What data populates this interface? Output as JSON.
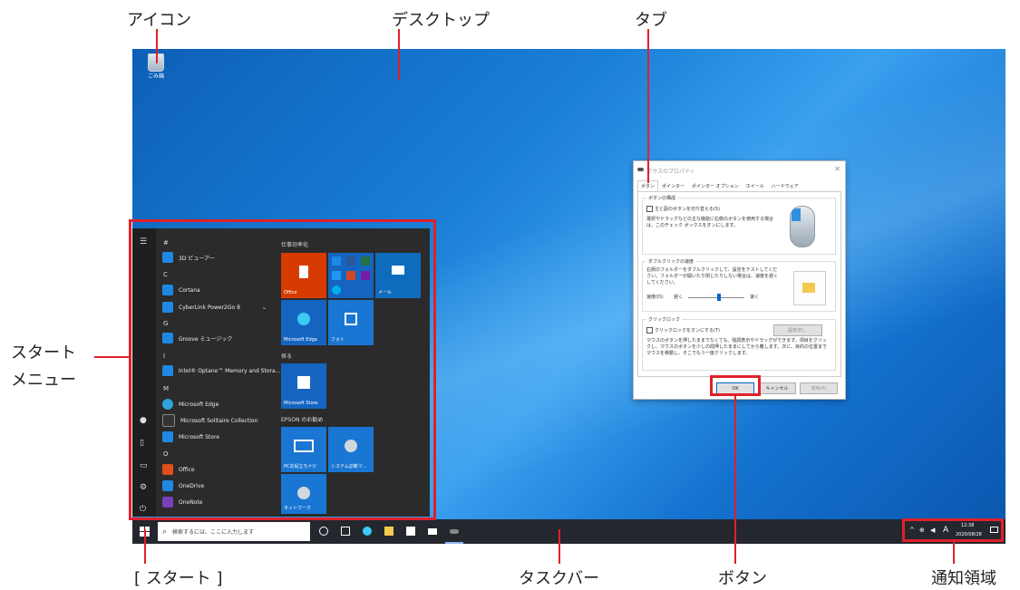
{
  "callouts": {
    "icon": "アイコン",
    "desktop": "デスクトップ",
    "tab": "タブ",
    "start_menu_1": "スタート",
    "start_menu_2": "メニュー",
    "start_button": "[ スタート ]",
    "taskbar": "タスクバー",
    "button": "ボタン",
    "notification_area": "通知領域"
  },
  "desktop": {
    "recycle_bin_label": "ごみ箱"
  },
  "start_menu": {
    "sections": {
      "hash": "#",
      "c": "C",
      "g": "G",
      "i": "I",
      "m": "M",
      "o": "O"
    },
    "apps": {
      "viewer3d": "3D ビューアー",
      "cortana": "Cortana",
      "cyberlink": "CyberLink Power2Go 8",
      "groove": "Groove ミュージック",
      "optane": "Intel® Optane™ Memory and Stora...",
      "edge": "Microsoft Edge",
      "solitaire": "Microsoft Solitaire Collection",
      "store": "Microsoft Store",
      "office": "Office",
      "onedrive": "OneDrive",
      "onenote": "OneNote"
    },
    "groups": {
      "productivity": "仕事効率化",
      "explore": "探る",
      "epson": "EPSON のお勧め"
    },
    "tiles": {
      "office": "Office",
      "mail": "メール",
      "edge": "Microsoft Edge",
      "photos": "フォト",
      "store": "Microsoft Store",
      "pc_help": "PCお役立ちナビ",
      "diag": "システム診断ツ...",
      "network": "ネットワーク"
    }
  },
  "taskbar": {
    "search_placeholder": "検索するには、ここに入力します",
    "ime": "A",
    "time": "12:38",
    "date": "2020/08/28"
  },
  "dialog": {
    "title": "マウスのプロパティ",
    "tabs": [
      "ボタン",
      "ポインター",
      "ポインター オプション",
      "ホイール",
      "ハードウェア"
    ],
    "group1_title": "ボタンの構成",
    "swap_checkbox": "主と副のボタンを切り替える(S)",
    "swap_desc": "選択やドラッグなどの主な機能に右側のボタンを使用する場合は、このチェック ボックスをオンにします。",
    "group2_title": "ダブルクリックの速度",
    "dbl_desc": "右側のフォルダーをダブルクリックして、設定をテストしてください。フォルダーが開いたり閉じたりしない場合は、速度を遅くしてください。",
    "speed_label": "速度(D):",
    "slow": "遅く",
    "fast": "速く",
    "group3_title": "クリックロック",
    "clicklock_checkbox": "クリックロックをオンにする(T)",
    "settings_button": "設定(E)...",
    "clicklock_desc": "マウスのボタンを押したままでなくても、強調表示やドラッグができます。項目をクリックし、マウスのボタンを少しの間押したままにしてから離します。次に、目的の位置までマウスを移動し、そこでもう一度クリックします。",
    "ok": "OK",
    "cancel": "キャンセル",
    "apply": "適用(A)"
  },
  "colors": {
    "accent": "#e0202a",
    "desktop": "#1a7fd6",
    "start_bg": "#2b2b2b",
    "taskbar": "#24272e"
  }
}
